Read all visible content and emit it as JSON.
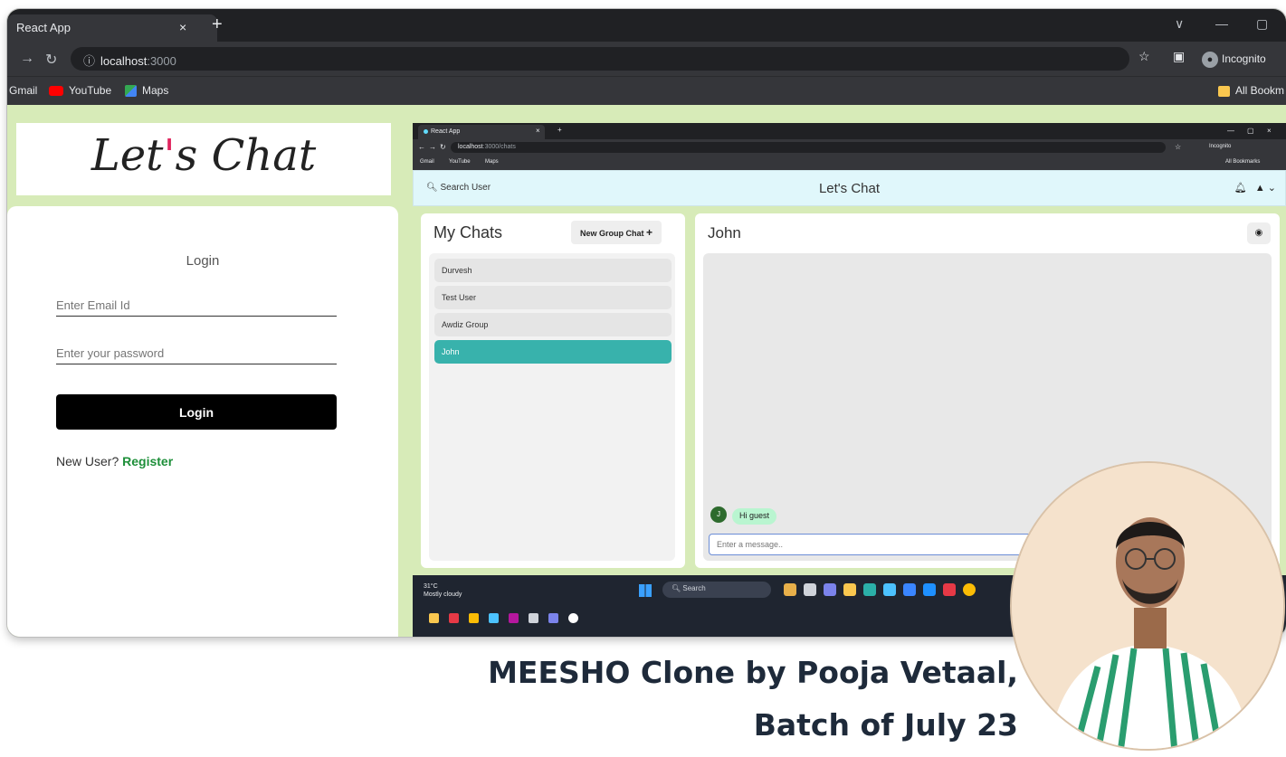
{
  "outer_browser": {
    "tab_title": "React App",
    "tab_close": "×",
    "new_tab": "+",
    "url_host": "localhost",
    "url_rest": ":3000",
    "incognito": "Incognito",
    "bookmarks": [
      "Gmail",
      "YouTube",
      "Maps"
    ],
    "all_bookmarks": "All Bookm"
  },
  "login_page": {
    "logo": {
      "before": "Let",
      "accent": "'",
      "after": "s Chat"
    },
    "title": "Login",
    "email_placeholder": "Enter Email Id",
    "password_placeholder": "Enter your password",
    "login_button": "Login",
    "new_user_text": "New User? ",
    "register_link": "Register"
  },
  "inner_browser": {
    "tab_title": "React App",
    "url_host": "localhost",
    "url_rest": ":3000/chats",
    "incognito": "Incognito",
    "bookmarks": [
      "Gmail",
      "YouTube",
      "Maps"
    ],
    "all_bookmarks": "All Bookmarks",
    "app": {
      "search_label": "Search User",
      "title": "Let's Chat",
      "my_chats_title": "My Chats",
      "new_group_button": "New Group Chat",
      "chats": [
        {
          "name": "Durvesh",
          "active": false
        },
        {
          "name": "Test User",
          "active": false
        },
        {
          "name": "Awdiz Group",
          "active": false
        },
        {
          "name": "John",
          "active": true
        }
      ],
      "chat_header": "John",
      "message_avatar": "J",
      "message_text": "Hi guest",
      "message_placeholder": "Enter a message.."
    },
    "taskbar": {
      "weather_temp": "31°C",
      "weather_desc": "Mostly cloudy",
      "search_label": "Search"
    }
  },
  "caption": {
    "line1": "MEESHO Clone by Pooja Vetaal,",
    "line2": "Batch of July 23"
  },
  "colors": {
    "page_bg": "#d7ebb8",
    "login_button": "#000000",
    "register_link": "#1e8f3a",
    "active_chat": "#38b2ac",
    "app_bar": "#e0f7fb",
    "message_bubble": "#b9f5d0"
  }
}
